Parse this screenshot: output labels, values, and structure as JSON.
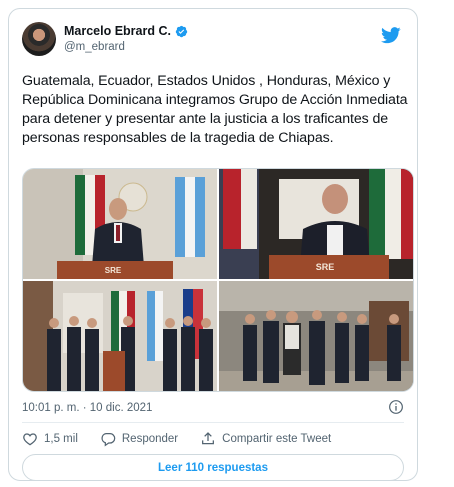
{
  "author": {
    "display_name": "Marcelo Ebrard C.",
    "handle": "@m_ebrard",
    "verified": true
  },
  "tweet": {
    "text": "Guatemala, Ecuador, Estados Unidos , Honduras, México y República Dominicana integramos Grupo de Acción Inmediata para detener y presentar ante la justicia a los traficantes de personas  responsables de la tragedia de Chiapas."
  },
  "media": {
    "photo_count": 4,
    "podium_sign_1": "SRE",
    "podium_sign_2": "SRE"
  },
  "meta": {
    "timestamp": "10:01 p. m. · 10 dic. 2021"
  },
  "actions": {
    "like_count": "1,5 mil",
    "reply_label": "Responder",
    "share_label": "Compartir este Tweet"
  },
  "read_replies_label": "Leer 110 respuestas",
  "colors": {
    "accent": "#1d9bf0",
    "text_secondary": "#536471",
    "border": "#cfd9de"
  },
  "icons": [
    "verified-badge-icon",
    "twitter-bird-icon",
    "info-icon",
    "heart-icon",
    "reply-bubble-icon",
    "share-upload-icon"
  ]
}
